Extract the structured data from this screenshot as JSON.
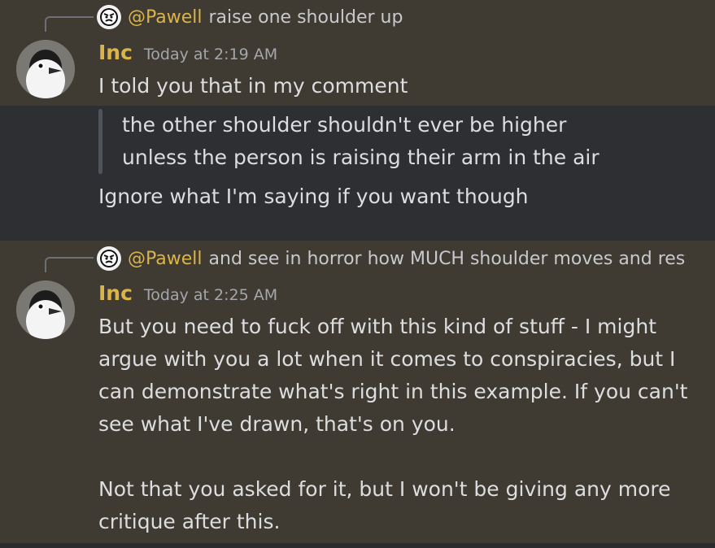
{
  "message1": {
    "reply": {
      "mention": "@Pawell",
      "text": "raise one shoulder up"
    },
    "author": "Inc",
    "timestamp": "Today at 2:19 AM",
    "first_line": "I told you that in my comment",
    "quote_lines": [
      "the other shoulder shouldn't ever be higher",
      "unless the person is raising their arm in the air"
    ],
    "last_line": "Ignore what I'm saying if you want though"
  },
  "message2": {
    "reply": {
      "mention": "@Pawell",
      "text": "and see in horror how MUCH shoulder moves and rest"
    },
    "author": "Inc",
    "timestamp": "Today at 2:25 AM",
    "lines": [
      "But you need to fuck off with this kind of stuff - I might",
      "argue with you a lot when it comes to conspiracies, but I",
      "can demonstrate what's right in this example. If you can't",
      "see what I've drawn, that's on you.",
      "",
      "Not that you asked for it, but I won't be giving any more",
      "critique after this."
    ]
  },
  "colors": {
    "username": "#d9b44a",
    "mention": "#d9b44a",
    "message_bg": "#3f3b33",
    "highlight_bg": "#2e2f33"
  }
}
